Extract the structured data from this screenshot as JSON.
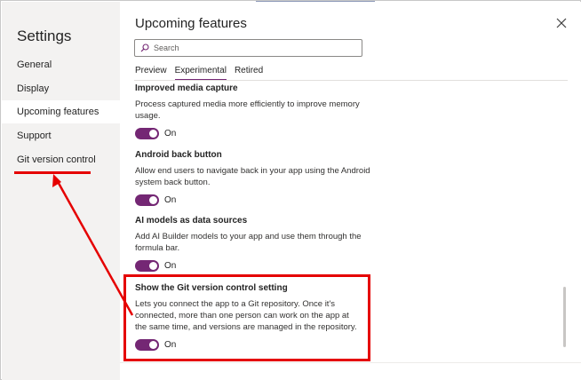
{
  "sidebar": {
    "title": "Settings",
    "items": [
      {
        "label": "General"
      },
      {
        "label": "Display"
      },
      {
        "label": "Upcoming features"
      },
      {
        "label": "Support"
      },
      {
        "label": "Git version control"
      }
    ],
    "active_index": 2
  },
  "main": {
    "title": "Upcoming features",
    "search": {
      "placeholder": "Search",
      "value": ""
    },
    "tabs": [
      {
        "label": "Preview"
      },
      {
        "label": "Experimental"
      },
      {
        "label": "Retired"
      }
    ],
    "active_tab_index": 1,
    "features": [
      {
        "title": "Improved media capture",
        "description": "Process captured media more efficiently to improve memory usage.",
        "toggle_label": "On",
        "enabled": true
      },
      {
        "title": "Android back button",
        "description": "Allow end users to navigate back in your app using the Android system back button.",
        "toggle_label": "On",
        "enabled": true
      },
      {
        "title": "AI models as data sources",
        "description": "Add AI Builder models to your app and use them through the formula bar.",
        "toggle_label": "On",
        "enabled": true
      },
      {
        "title": "Show the Git version control setting",
        "description": "Lets you connect the app to a Git repository. Once it's connected, more than one person can work on the app at the same time, and versions are managed in the repository.",
        "toggle_label": "On",
        "enabled": true
      }
    ]
  },
  "icons": {
    "close": "close-icon",
    "search": "search-icon"
  },
  "colors": {
    "accent": "#742774",
    "annotation": "#e50000",
    "sidebar_bg": "#f3f2f1"
  }
}
